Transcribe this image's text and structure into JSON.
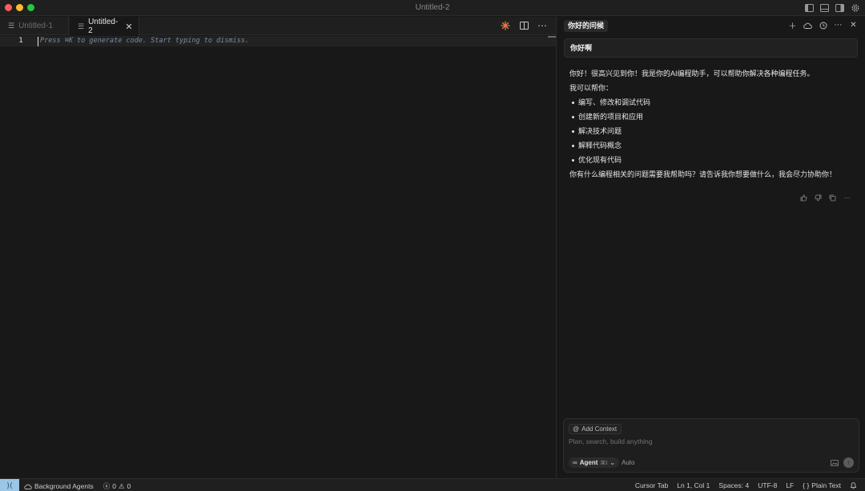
{
  "window": {
    "title": "Untitled-2"
  },
  "titlebar": {
    "icons": [
      "toggle-primary-sidebar-icon",
      "toggle-panel-icon",
      "toggle-secondary-sidebar-icon",
      "settings-gear-icon"
    ]
  },
  "editor": {
    "tabs": [
      {
        "label": "Untitled-1",
        "active": false
      },
      {
        "label": "Untitled-2",
        "active": true
      }
    ],
    "close_glyph": "✕",
    "line_number": "1",
    "hint_text": "Press ⌘K to generate code. Start typing to dismiss.",
    "actions": [
      "cursor-sparkle-icon",
      "split-editor-icon",
      "more-actions-icon"
    ]
  },
  "chat": {
    "tab_title": "你好的问候",
    "header_actions": [
      "new-chat-icon",
      "cloud-icon",
      "history-icon",
      "more-icon",
      "close-icon"
    ],
    "user_message": "你好啊",
    "reply": {
      "intro": "你好！很高兴见到你！我是你的AI编程助手，可以帮助你解决各种编程任务。",
      "lead": "我可以帮你：",
      "items": [
        "编写、修改和调试代码",
        "创建新的项目和应用",
        "解决技术问题",
        "解释代码概念",
        "优化现有代码"
      ],
      "closing": "你有什么编程相关的问题需要我帮助吗？请告诉我你想要做什么，我会尽力协助你！"
    },
    "feedback_icons": [
      "thumbs-up-icon",
      "thumbs-down-icon",
      "copy-icon",
      "more-icon"
    ],
    "composer": {
      "add_context": "Add Context",
      "placeholder": "Plan, search, build anything",
      "mode_label": "Agent",
      "mode_shortcut": "⌘I",
      "model_label": "Auto"
    }
  },
  "statusbar": {
    "background_agents": "Background Agents",
    "errors": "0",
    "warnings": "0",
    "cursor_tab": "Cursor Tab",
    "position": "Ln 1, Col 1",
    "spaces": "Spaces: 4",
    "encoding": "UTF-8",
    "eol": "LF",
    "language": "Plain Text"
  },
  "colors": {
    "remote_button": "#9bc6e6",
    "traffic_red": "#ff5f57",
    "traffic_yellow": "#febc2e",
    "traffic_green": "#28c840",
    "sparkle": "#e8784a"
  }
}
